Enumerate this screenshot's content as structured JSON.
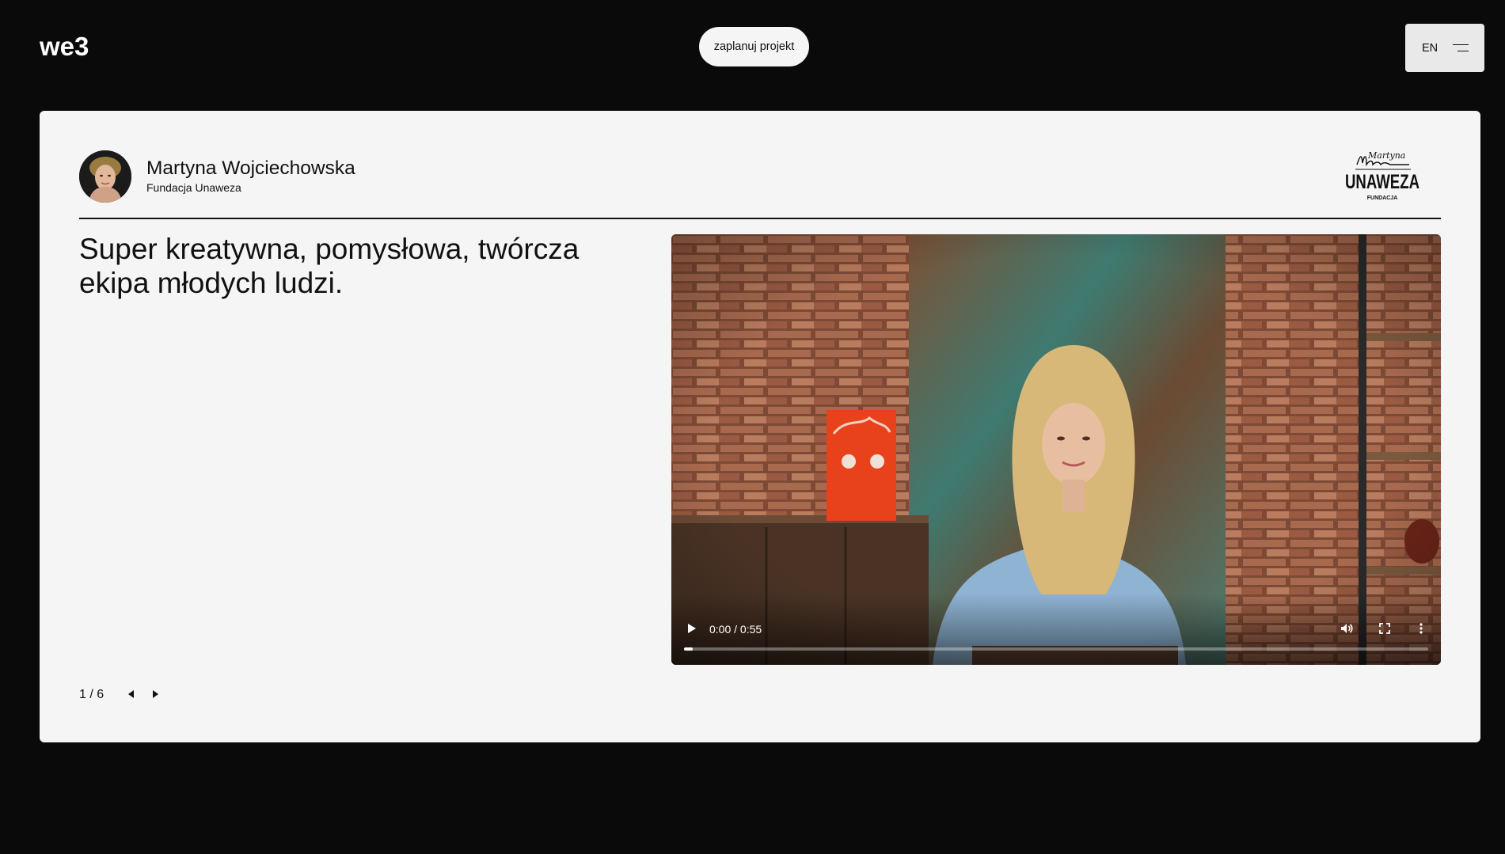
{
  "header": {
    "logo_text": "we3",
    "cta_label": "zaplanuj projekt",
    "language": "EN",
    "icons": {
      "menu": "hamburger-icon"
    }
  },
  "testimonial": {
    "person_name": "Martyna Wojciechowska",
    "organization": "Fundacja Unaweza",
    "org_logo": {
      "signature": "Martyna",
      "wordmark": "UNAWEZA",
      "sub": "FUNDACJA"
    },
    "quote": "Super kreatywna, pomysłowa, twórcza ekipa młodych ludzi.",
    "video": {
      "time": "0:00 / 0:55",
      "progress": 0.012,
      "icons": {
        "play": "play-icon",
        "volume": "volume-icon",
        "fullscreen": "fullscreen-icon",
        "more": "more-vertical-icon"
      }
    },
    "pagination": {
      "label": "1 / 6",
      "current": 1,
      "total": 6
    }
  },
  "colors": {
    "page_bg": "#0a0a0a",
    "card_bg": "#f5f5f5",
    "text": "#111111",
    "button_bg": "#f5f5f5"
  }
}
